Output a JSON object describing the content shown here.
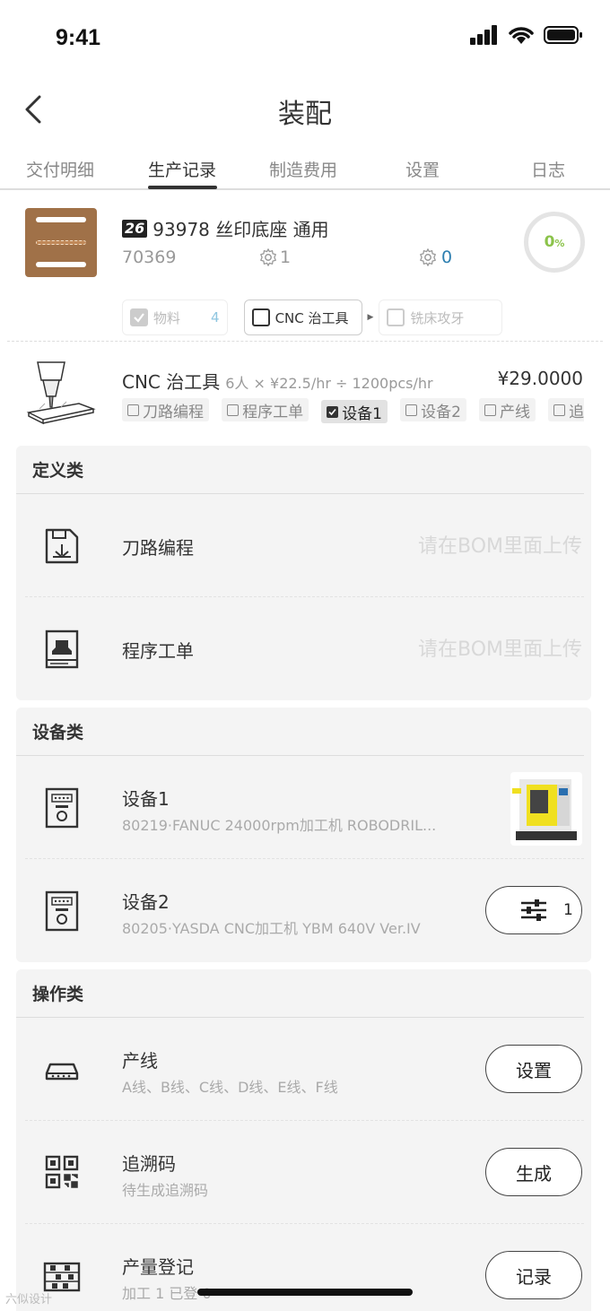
{
  "status_bar": {
    "time": "9:41"
  },
  "nav": {
    "title": "装配"
  },
  "tabs": [
    {
      "label": "交付明细"
    },
    {
      "label": "生产记录"
    },
    {
      "label": "制造费用"
    },
    {
      "label": "设置"
    },
    {
      "label": "日志"
    }
  ],
  "product": {
    "badge": "26",
    "name": "93978 丝印底座 通用",
    "code": "70369",
    "gear_count_1": "1",
    "gear_count_2": "0",
    "progress": "0",
    "progress_unit": "%"
  },
  "process_chips": [
    {
      "label": "物料",
      "count": "4",
      "checked": true
    },
    {
      "label": "CNC 治工具",
      "checked": false
    },
    {
      "label": "铣床攻牙",
      "checked": false
    }
  ],
  "cnc": {
    "title": "CNC 治工具",
    "meta": "6人 × ¥22.5/hr ÷ 1200pcs/hr",
    "price": "¥29.0000",
    "tags": [
      {
        "label": "刀路编程",
        "checked": false
      },
      {
        "label": "程序工单",
        "checked": false
      },
      {
        "label": "设备1",
        "checked": true
      },
      {
        "label": "设备2",
        "checked": false
      },
      {
        "label": "产线",
        "checked": false
      },
      {
        "label": "追",
        "checked": false
      }
    ]
  },
  "definition_section": {
    "header": "定义类",
    "rows": [
      {
        "label": "刀路编程",
        "hint": "请在BOM里面上传",
        "icon": "floppy-tool-icon"
      },
      {
        "label": "程序工单",
        "hint": "请在BOM里面上传",
        "icon": "worksheet-icon"
      }
    ]
  },
  "equipment_section": {
    "header": "设备类",
    "rows": [
      {
        "label": "设备1",
        "sub": "80219·FANUC 24000rpm加工机 ROBODRIL...",
        "icon": "machine-panel-icon"
      },
      {
        "label": "设备2",
        "sub": "80205·YASDA CNC加工机 YBM 640V Ver.IV",
        "icon": "machine-panel-icon",
        "button_count": "1"
      }
    ]
  },
  "operation_section": {
    "header": "操作类",
    "rows": [
      {
        "label": "产线",
        "sub": "A线、B线、C线、D线、E线、F线",
        "button": "设置",
        "icon": "production-line-icon"
      },
      {
        "label": "追溯码",
        "sub": "待生成追溯码",
        "button": "生成",
        "icon": "qr-code-icon"
      },
      {
        "label": "产量登记",
        "sub": "加工 1    已登 0",
        "button": "记录",
        "icon": "abacus-icon"
      }
    ]
  },
  "watermark": "六似设计"
}
